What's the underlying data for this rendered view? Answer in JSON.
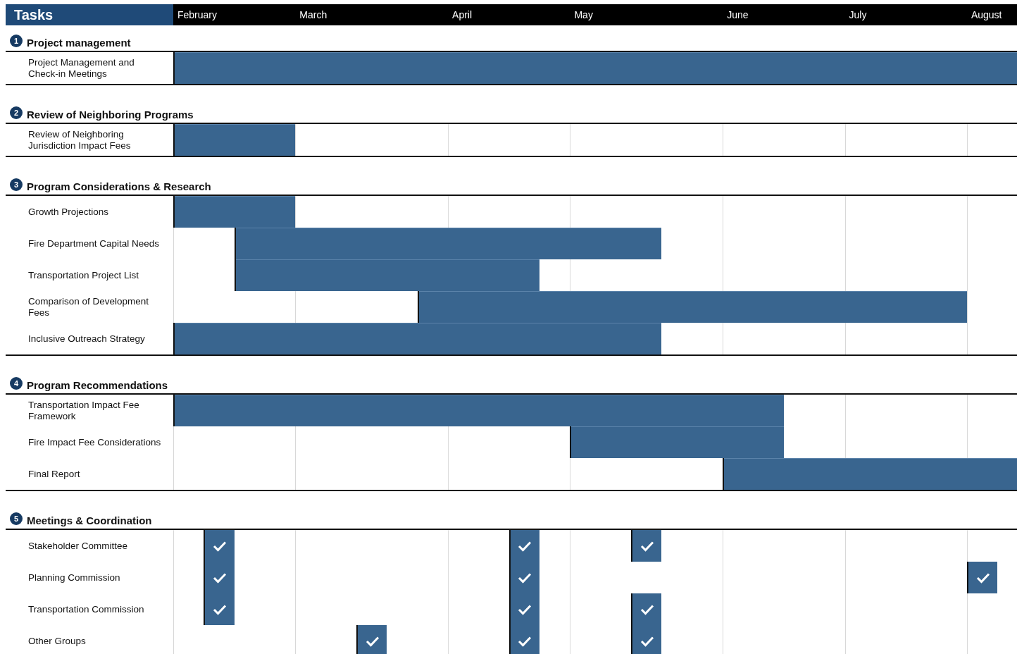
{
  "header": {
    "title": "Tasks",
    "months": [
      "February",
      "March",
      "April",
      "May",
      "June",
      "July",
      "August"
    ]
  },
  "sections": [
    {
      "number": "1",
      "title": "Project management",
      "kind": "schedule",
      "tasks": [
        {
          "name": "Project Management and Check-in Meetings",
          "weeks": [
            true,
            true,
            true,
            true,
            true,
            true,
            true,
            true,
            true,
            true,
            true,
            true,
            true,
            true,
            true,
            true,
            true,
            true,
            true,
            true,
            true,
            true,
            true,
            true,
            true,
            true,
            true,
            true
          ]
        }
      ]
    },
    {
      "number": "2",
      "title": "Review of Neighboring Programs",
      "kind": "schedule",
      "tasks": [
        {
          "name": "Review of Neighboring Jurisdiction Impact Fees",
          "weeks": [
            true,
            true,
            true,
            true,
            false,
            false,
            false,
            false,
            false,
            false,
            false,
            false,
            false,
            false,
            false,
            false,
            false,
            false,
            false,
            false,
            false,
            false,
            false,
            false,
            false,
            false,
            false,
            false
          ]
        }
      ]
    },
    {
      "number": "3",
      "title": "Program Considerations & Research",
      "kind": "schedule",
      "tasks": [
        {
          "name": "Growth Projections",
          "weeks": [
            true,
            true,
            true,
            true,
            false,
            false,
            false,
            false,
            false,
            false,
            false,
            false,
            false,
            false,
            false,
            false,
            false,
            false,
            false,
            false,
            false,
            false,
            false,
            false,
            false,
            false,
            false,
            false
          ]
        },
        {
          "name": "Fire Department Capital Needs",
          "weeks": [
            false,
            false,
            true,
            true,
            true,
            true,
            true,
            true,
            true,
            true,
            true,
            true,
            true,
            true,
            true,
            true,
            false,
            false,
            false,
            false,
            false,
            false,
            false,
            false,
            false,
            false,
            false,
            false
          ]
        },
        {
          "name": "Transportation Project List",
          "weeks": [
            false,
            false,
            true,
            true,
            true,
            true,
            true,
            true,
            true,
            true,
            true,
            true,
            false,
            false,
            false,
            false,
            false,
            false,
            false,
            false,
            false,
            false,
            false,
            false,
            false,
            false,
            false,
            false
          ]
        },
        {
          "name": "Comparison of Development Fees",
          "weeks": [
            false,
            false,
            false,
            false,
            false,
            false,
            false,
            false,
            true,
            true,
            true,
            true,
            true,
            true,
            true,
            true,
            true,
            true,
            true,
            true,
            true,
            true,
            true,
            true,
            true,
            true,
            false,
            false
          ]
        },
        {
          "name": "Inclusive Outreach Strategy",
          "weeks": [
            true,
            true,
            true,
            true,
            true,
            true,
            true,
            true,
            true,
            true,
            true,
            true,
            true,
            true,
            true,
            true,
            false,
            false,
            false,
            false,
            false,
            false,
            false,
            false,
            false,
            false,
            false,
            false
          ]
        }
      ]
    },
    {
      "number": "4",
      "title": "Program Recommendations",
      "kind": "schedule",
      "tasks": [
        {
          "name": "Transportation Impact Fee Framework",
          "weeks": [
            true,
            true,
            true,
            true,
            true,
            true,
            true,
            true,
            true,
            true,
            true,
            true,
            true,
            true,
            true,
            true,
            true,
            true,
            true,
            true,
            false,
            false,
            false,
            false,
            false,
            false,
            false,
            false
          ]
        },
        {
          "name": "Fire Impact Fee Considerations",
          "weeks": [
            false,
            false,
            false,
            false,
            false,
            false,
            false,
            false,
            false,
            false,
            false,
            false,
            false,
            true,
            true,
            true,
            true,
            true,
            true,
            true,
            false,
            false,
            false,
            false,
            false,
            false,
            false,
            false
          ]
        },
        {
          "name": "Final Report",
          "weeks": [
            false,
            false,
            false,
            false,
            false,
            false,
            false,
            false,
            false,
            false,
            false,
            false,
            false,
            false,
            false,
            false,
            false,
            false,
            true,
            true,
            true,
            true,
            true,
            true,
            true,
            true,
            true,
            true
          ]
        }
      ]
    },
    {
      "number": "5",
      "title": "Meetings & Coordination",
      "kind": "meetings",
      "tasks": [
        {
          "name": "Stakeholder Committee",
          "weeks": [
            false,
            true,
            false,
            false,
            false,
            false,
            false,
            false,
            false,
            false,
            false,
            true,
            false,
            false,
            false,
            true,
            false,
            false,
            false,
            false,
            false,
            false,
            false,
            false,
            false,
            false,
            false,
            false
          ]
        },
        {
          "name": "Planning Commission",
          "weeks": [
            false,
            true,
            false,
            false,
            false,
            false,
            false,
            false,
            false,
            false,
            false,
            true,
            false,
            false,
            false,
            false,
            false,
            false,
            false,
            false,
            false,
            false,
            false,
            false,
            false,
            false,
            true,
            false
          ]
        },
        {
          "name": "Transportation Commission",
          "weeks": [
            false,
            true,
            false,
            false,
            false,
            false,
            false,
            false,
            false,
            false,
            false,
            true,
            false,
            false,
            false,
            true,
            false,
            false,
            false,
            false,
            false,
            false,
            false,
            false,
            false,
            false,
            false,
            false
          ]
        },
        {
          "name": "Other Groups",
          "weeks": [
            false,
            false,
            false,
            false,
            false,
            false,
            true,
            false,
            false,
            false,
            false,
            true,
            false,
            false,
            false,
            true,
            false,
            false,
            false,
            false,
            false,
            false,
            false,
            false,
            false,
            false,
            false,
            false
          ]
        }
      ]
    }
  ]
}
